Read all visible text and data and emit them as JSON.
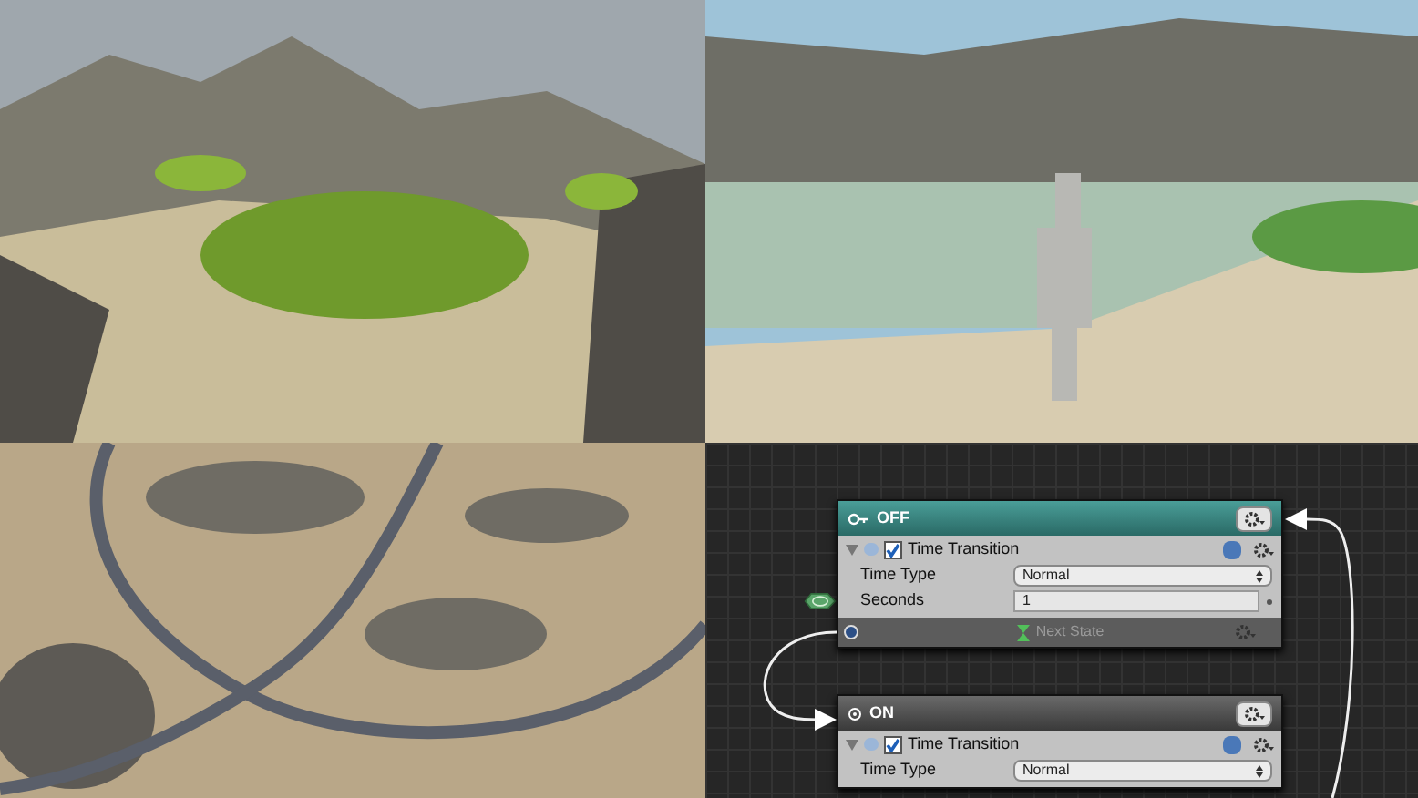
{
  "state_graph": {
    "states": [
      {
        "name": "OFF",
        "start": true,
        "actions": [
          {
            "title": "Time Transition",
            "enabled": true,
            "fields": [
              {
                "label": "Time Type",
                "kind": "select",
                "value": "Normal"
              },
              {
                "label": "Seconds",
                "kind": "number",
                "value": "1"
              }
            ]
          }
        ],
        "transition": "Next State"
      },
      {
        "name": "ON",
        "start": false,
        "actions": [
          {
            "title": "Time Transition",
            "enabled": true,
            "fields": [
              {
                "label": "Time Type",
                "kind": "select",
                "value": "Normal"
              }
            ]
          }
        ]
      }
    ]
  }
}
